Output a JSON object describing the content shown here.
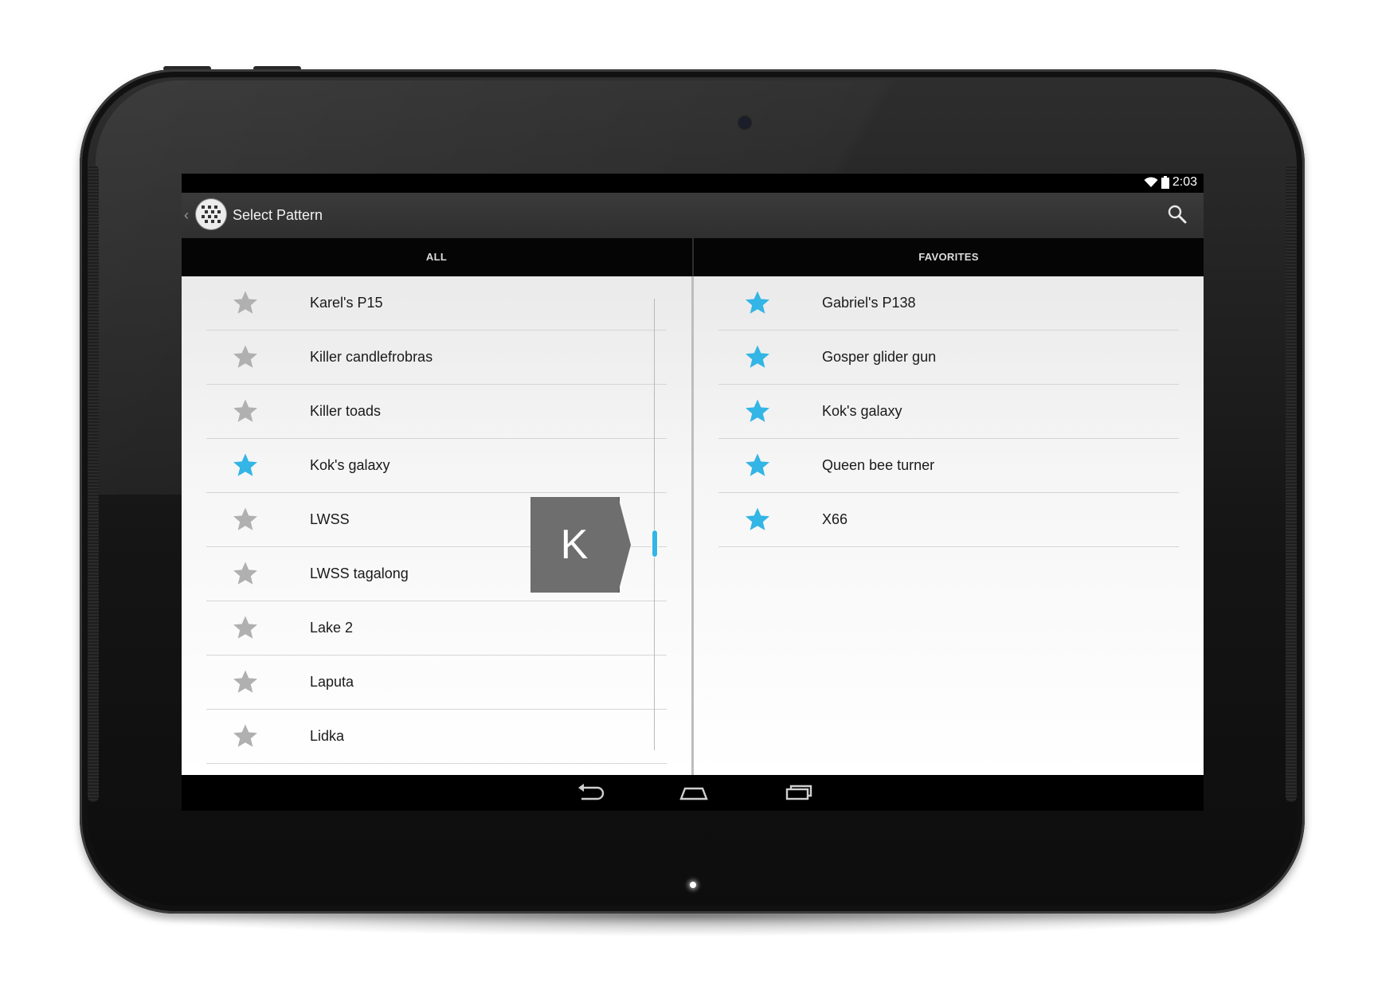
{
  "status_bar": {
    "time": "2:03",
    "wifi_icon": "wifi-icon",
    "battery_icon": "battery-icon"
  },
  "action_bar": {
    "title": "Select Pattern",
    "up_icon": "chevron-left-icon",
    "app_icon": "pattern-app-icon",
    "search_icon": "search-icon"
  },
  "tabs": [
    {
      "label": "ALL"
    },
    {
      "label": "FAVORITES"
    }
  ],
  "all_list": [
    {
      "name": "Karel's P15",
      "favorite": false
    },
    {
      "name": "Killer candlefrobras",
      "favorite": false
    },
    {
      "name": "Killer toads",
      "favorite": false
    },
    {
      "name": "Kok's galaxy",
      "favorite": true
    },
    {
      "name": "LWSS",
      "favorite": false
    },
    {
      "name": "LWSS tagalong",
      "favorite": false
    },
    {
      "name": "Lake 2",
      "favorite": false
    },
    {
      "name": "Laputa",
      "favorite": false
    },
    {
      "name": "Lidka",
      "favorite": false
    }
  ],
  "favorites_list": [
    {
      "name": "Gabriel's P138",
      "favorite": true
    },
    {
      "name": "Gosper glider gun",
      "favorite": true
    },
    {
      "name": "Kok's galaxy",
      "favorite": true
    },
    {
      "name": "Queen bee turner",
      "favorite": true
    },
    {
      "name": "X66",
      "favorite": true
    }
  ],
  "fast_scroll": {
    "index_letter": "K"
  },
  "nav_bar": {
    "back_icon": "back-icon",
    "home_icon": "home-icon",
    "recents_icon": "recents-icon"
  },
  "colors": {
    "accent": "#33b5e5",
    "star_off": "#b0b0b0",
    "star_on": "#33b5e5"
  }
}
